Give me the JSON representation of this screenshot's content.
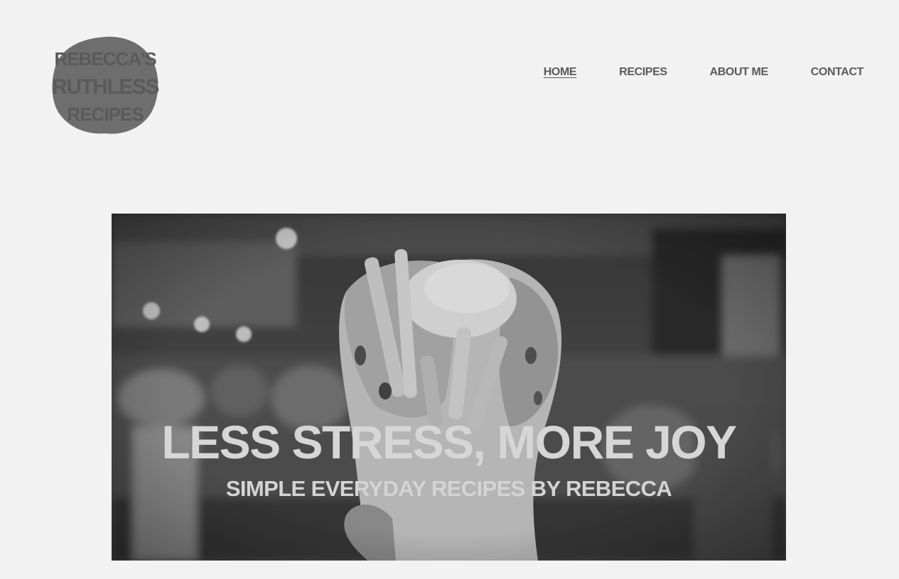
{
  "brand": {
    "logo_icon": "rebeccas-ruthless-recipes-logo",
    "logo_text": [
      "REBECCA'S",
      "RUTHLESS",
      "RECIPES"
    ]
  },
  "nav": {
    "items": [
      {
        "label": "HOME",
        "active": true
      },
      {
        "label": "RECIPES",
        "active": false
      },
      {
        "label": "ABOUT ME",
        "active": false
      },
      {
        "label": "CONTACT",
        "active": false
      }
    ]
  },
  "hero": {
    "title": "LESS STRESS, MORE JOY",
    "subtitle": "SIMPLE EVERYDAY RECIPES BY REBECCA",
    "image_icon": "gyro-wrap-photo"
  },
  "colors": {
    "background": "#f2f2f2",
    "nav_text": "#5a5a5a",
    "logo_fill": "#6e6e6e",
    "hero_text": "#d6d6d6"
  }
}
